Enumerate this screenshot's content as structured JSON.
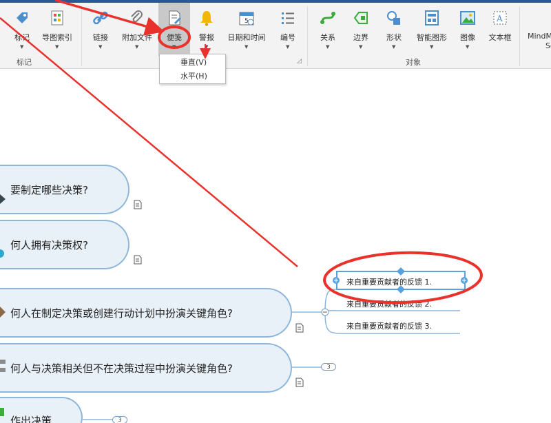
{
  "ribbon": {
    "groups": [
      {
        "label": "标记"
      },
      {
        "label": "对象"
      }
    ],
    "buttons": [
      {
        "label": "标记",
        "icon": "tag-icon"
      },
      {
        "label": "导图索引",
        "icon": "map-index-icon"
      },
      {
        "label": "链接",
        "icon": "link-icon"
      },
      {
        "label": "附加文件",
        "icon": "paperclip-icon"
      },
      {
        "label": "便笺",
        "icon": "note-icon"
      },
      {
        "label": "警报",
        "icon": "bell-icon"
      },
      {
        "label": "日期和时间",
        "icon": "calendar-icon"
      },
      {
        "label": "编号",
        "icon": "numbered-list-icon"
      },
      {
        "label": "关系",
        "icon": "relationship-icon"
      },
      {
        "label": "边界",
        "icon": "boundary-icon"
      },
      {
        "label": "形状",
        "icon": "shapes-icon"
      },
      {
        "label": "智能图形",
        "icon": "smartshape-icon"
      },
      {
        "label": "图像",
        "icon": "image-icon"
      },
      {
        "label": "文本框",
        "icon": "textbox-icon"
      },
      {
        "label": "MindM",
        "label2": "Sc",
        "icon": "mindmanager-icon"
      }
    ],
    "dropdown": {
      "items": [
        "垂直(V)",
        "水平(H)"
      ]
    }
  },
  "canvas": {
    "topics": [
      {
        "text": "要制定哪些决策?"
      },
      {
        "text": "何人拥有决策权?"
      },
      {
        "text": "何人在制定决策或创建行动计划中扮演关键角色?"
      },
      {
        "text": "何人与决策相关但不在决策过程中扮演关键角色?"
      },
      {
        "text": "作出决策"
      }
    ],
    "subtopics": [
      {
        "text": "来自重要贡献者的反馈 1."
      },
      {
        "text": "来自重要贡献者的反馈 2."
      },
      {
        "text": "来自重要贡献者的反馈 3."
      }
    ],
    "badges": [
      "3",
      "3"
    ]
  },
  "colors": {
    "annotation_red": "#e8322b",
    "topic_fill": "#e9f1f8",
    "topic_border": "#8fb6da",
    "ribbon_bg": "#f3f3f3"
  }
}
